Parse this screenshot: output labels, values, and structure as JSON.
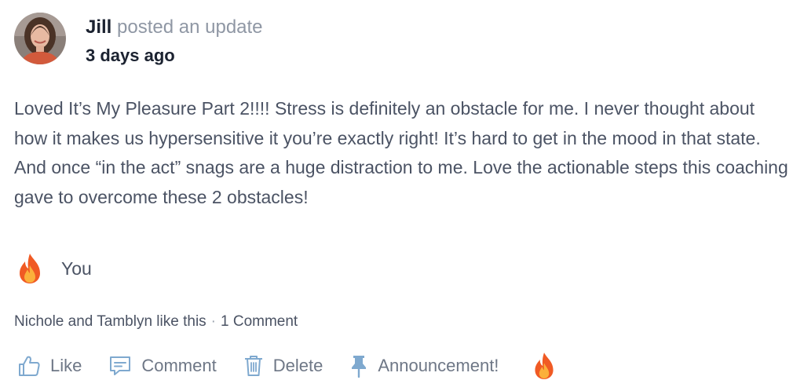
{
  "post": {
    "author": "Jill",
    "action_text": "posted an update",
    "time": "3 days ago",
    "body": "Loved It’s My Pleasure Part 2!!!! Stress is definitely an obstacle for me. I never thought about how it makes us hypersensitive it you’re exactly right! It’s hard to get in the mood in that state. And once “in the act” snags are a huge distraction to me. Love the actionable steps this coaching gave to overcome these 2 obstacles!"
  },
  "reactions": {
    "emoji_icon": "fire-icon",
    "label": "You"
  },
  "stats": {
    "likes_text": "Nichole and Tamblyn like this",
    "separator": "·",
    "comments_text": "1 Comment"
  },
  "actions": {
    "like_label": "Like",
    "comment_label": "Comment",
    "delete_label": "Delete",
    "announcement_label": "Announcement!"
  },
  "colors": {
    "icon": "#7fa9cf",
    "text": "#4b5364",
    "muted": "#8f97a4",
    "fire_outer": "#f05a24",
    "fire_inner": "#fbb03b"
  }
}
